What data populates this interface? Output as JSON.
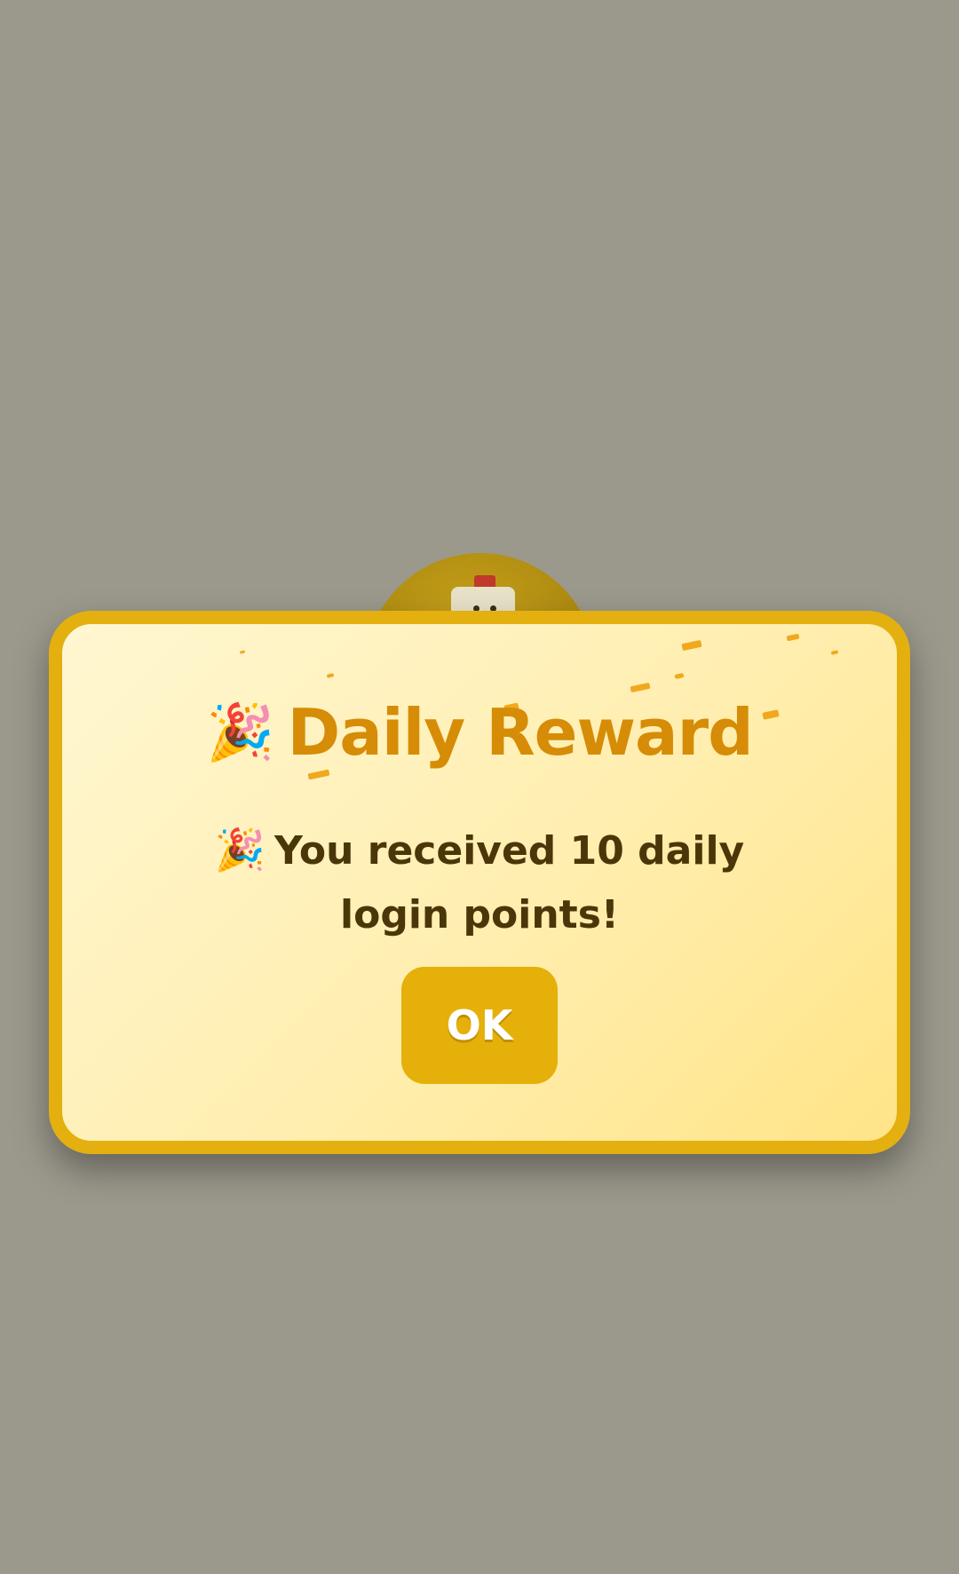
{
  "dialog": {
    "title_icon": "party-popper-icon",
    "title_emoji": "🎉",
    "title": "Daily Reward",
    "message_icon": "party-popper-icon",
    "message_emoji": "🎉",
    "message": "You received 10 daily login points!",
    "ok_label": "OK"
  },
  "colors": {
    "backdrop": "#9b998c",
    "dialog_border": "#e3b010",
    "title": "#d68c06",
    "message": "#4a3608",
    "button": "#e6b00a"
  },
  "background": {
    "mascot_icon": "chicken-mascot-icon"
  }
}
